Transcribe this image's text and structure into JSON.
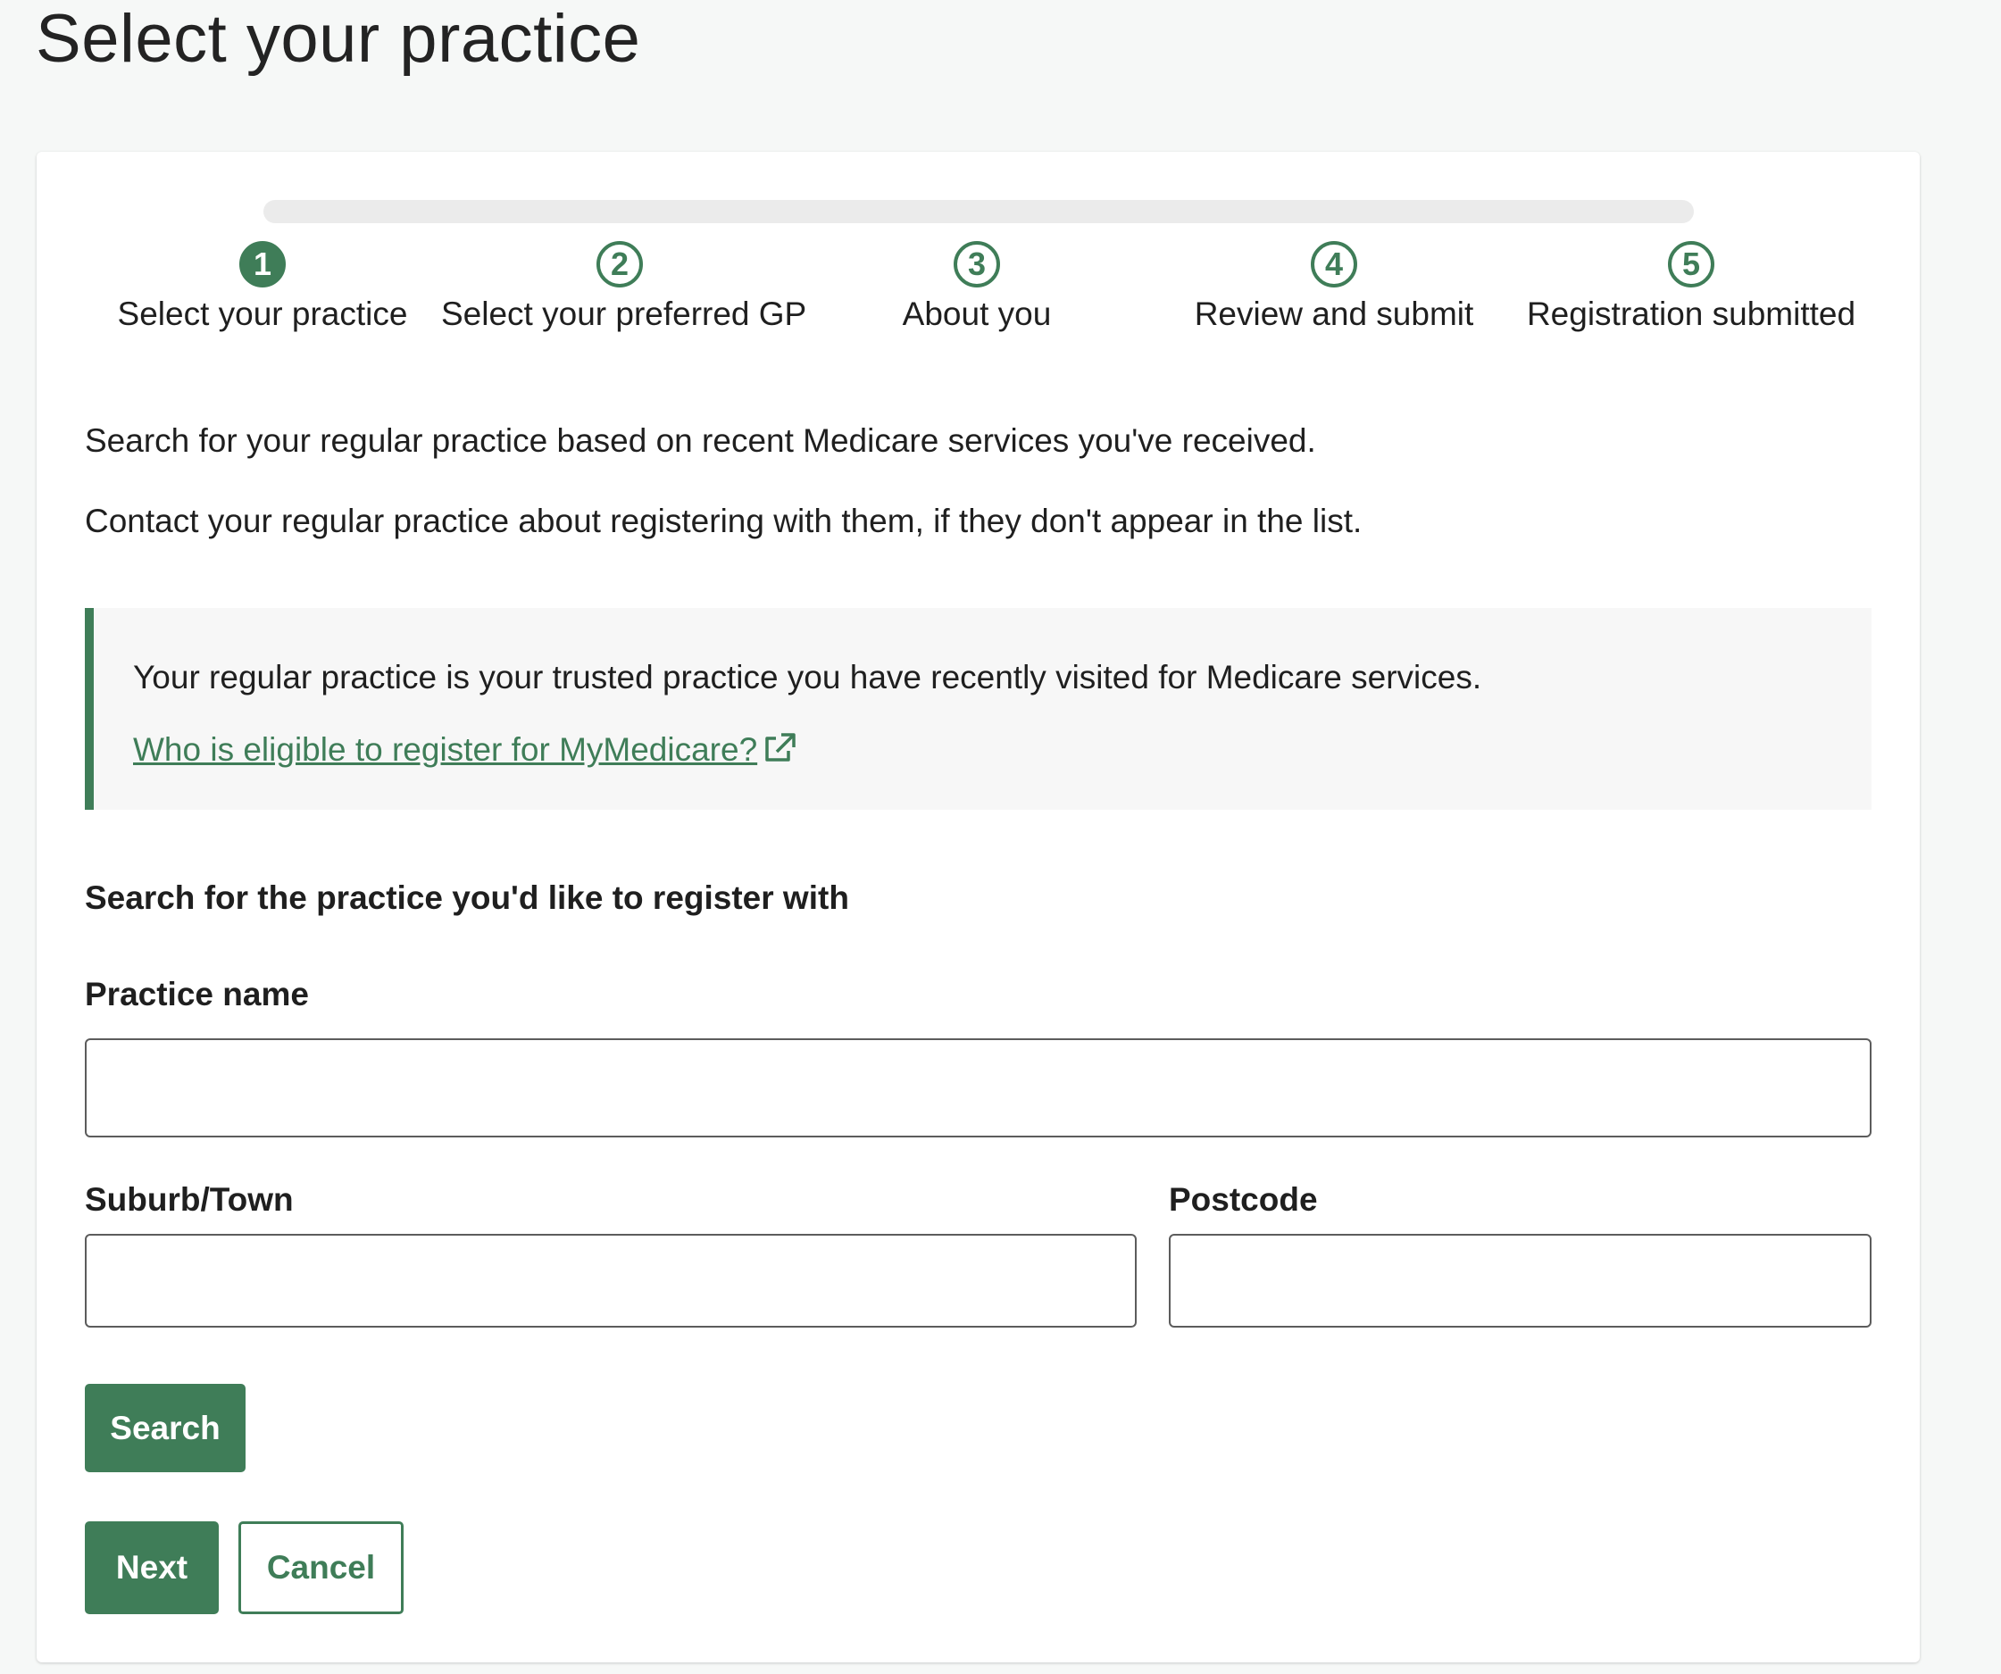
{
  "page": {
    "title": "Select your practice"
  },
  "stepper": {
    "steps": [
      {
        "number": "1",
        "label": "Select your practice",
        "state": "current"
      },
      {
        "number": "2",
        "label": "Select your preferred GP",
        "state": "upcoming"
      },
      {
        "number": "3",
        "label": "About you",
        "state": "upcoming"
      },
      {
        "number": "4",
        "label": "Review and submit",
        "state": "upcoming"
      },
      {
        "number": "5",
        "label": "Registration submitted",
        "state": "upcoming"
      }
    ]
  },
  "intro": {
    "line1": "Search for your regular practice based on recent Medicare services you've received.",
    "line2": "Contact your regular practice about registering with them, if they don't appear in the list."
  },
  "info_box": {
    "text": "Your regular practice is your trusted practice you have recently visited for Medicare services.",
    "link_label": "Who is eligible to register for MyMedicare?",
    "link_icon": "external-link-icon"
  },
  "form": {
    "heading": "Search for the practice you'd like to register with",
    "practice_name": {
      "label": "Practice name",
      "value": ""
    },
    "suburb": {
      "label": "Suburb/Town",
      "value": ""
    },
    "postcode": {
      "label": "Postcode",
      "value": ""
    },
    "search_label": "Search"
  },
  "actions": {
    "next_label": "Next",
    "cancel_label": "Cancel"
  },
  "colors": {
    "accent": "#3f7d58",
    "page_background": "#f6f8f7",
    "info_background": "#f7f7f7",
    "text": "#1f1f1f"
  }
}
